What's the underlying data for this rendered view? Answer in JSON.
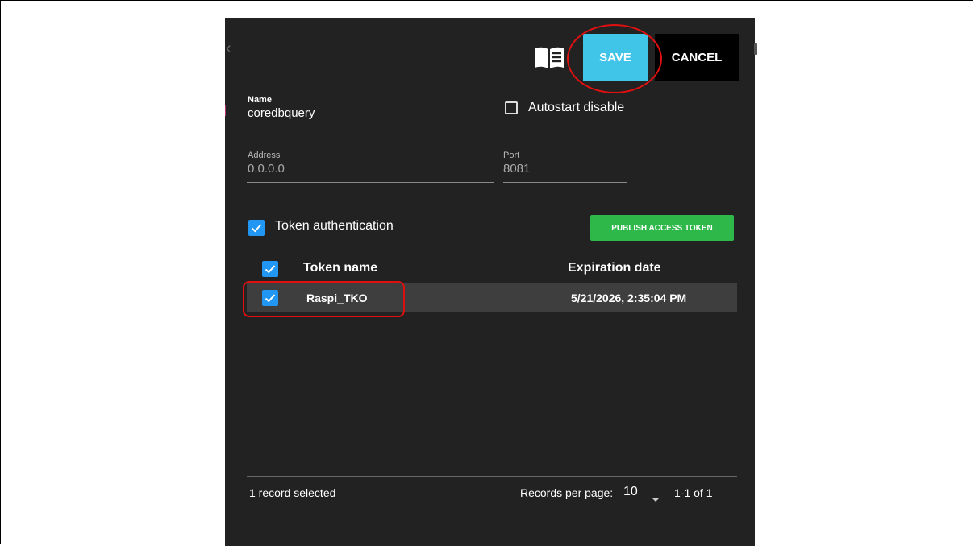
{
  "toolbar": {
    "save_label": "SAVE",
    "cancel_label": "CANCEL",
    "help_icon": "book-icon"
  },
  "form": {
    "name_label": "Name",
    "name_value": "coredbquery",
    "autostart_label": "Autostart disable",
    "autostart_checked": false,
    "address_label": "Address",
    "address_value": "0.0.0.0",
    "port_label": "Port",
    "port_value": "8081"
  },
  "token": {
    "auth_label": "Token authentication",
    "auth_checked": true,
    "publish_label": "PUBLISH ACCESS TOKEN",
    "table": {
      "columns": [
        "Token name",
        "Expiration date"
      ],
      "rows": [
        {
          "name": "Raspi_TKO",
          "expiration": "5/21/2026, 2:35:04 PM",
          "checked": true
        }
      ]
    }
  },
  "footer": {
    "selected_text": "1 record selected",
    "per_page_label": "Records per page:",
    "per_page_value": "10",
    "range_text": "1-1 of 1"
  },
  "colors": {
    "panel_bg": "#222222",
    "save_bg": "#40c4e8",
    "cancel_bg": "#000000",
    "publish_bg": "#2eb84a",
    "checkbox_blue": "#2196f3",
    "annotation_red": "#e01010"
  }
}
